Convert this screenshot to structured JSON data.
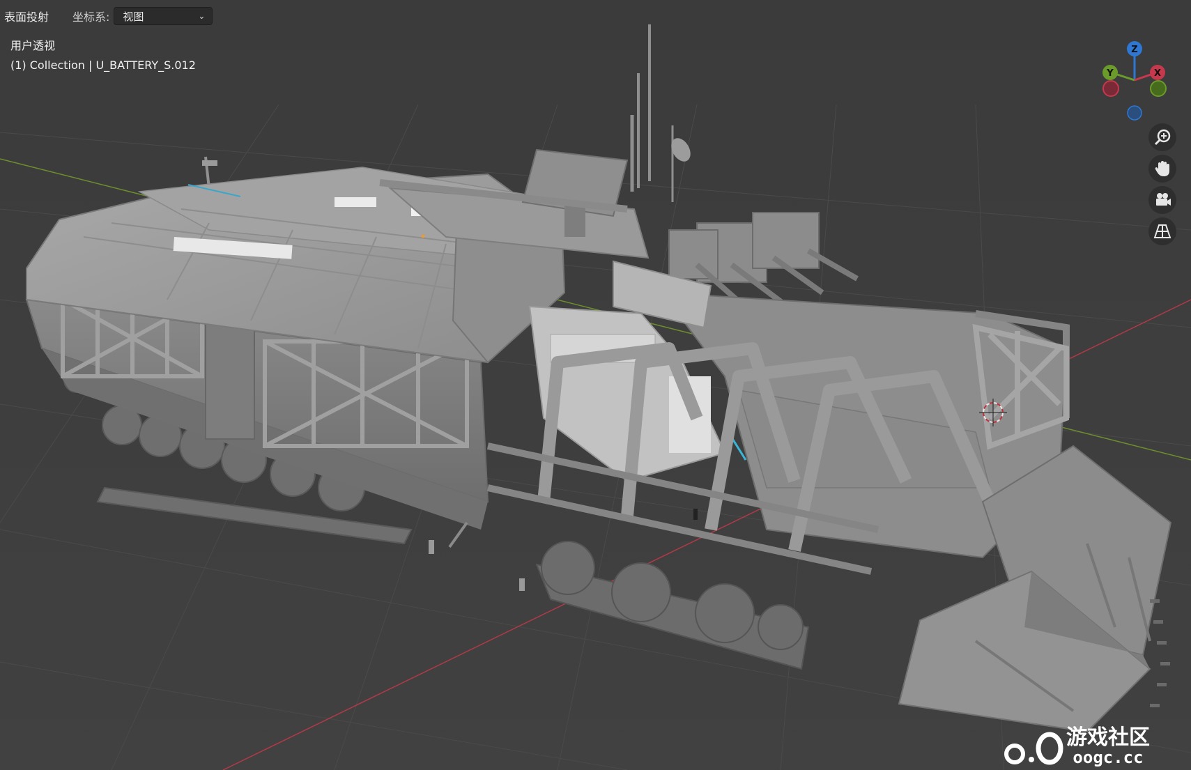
{
  "header": {
    "snap_label": "表面投射",
    "coord_label": "坐标系:",
    "coord_value": "视图"
  },
  "viewport": {
    "view_name": "用户透视",
    "collection_info": "(1) Collection | U_BATTERY_S.012"
  },
  "gizmo": {
    "axis_z": "Z",
    "axis_y": "Y",
    "axis_x": "X",
    "colors": {
      "x": "#c6394d",
      "y": "#6b9b2a",
      "z": "#2e78d4"
    }
  },
  "nav_tools": [
    {
      "icon": "zoom-icon"
    },
    {
      "icon": "hand-pan-icon"
    },
    {
      "icon": "camera-icon"
    },
    {
      "icon": "grid-perspective-icon"
    }
  ],
  "watermark": {
    "logo_text": "游戏社区",
    "site_text": "oogc.cc"
  }
}
